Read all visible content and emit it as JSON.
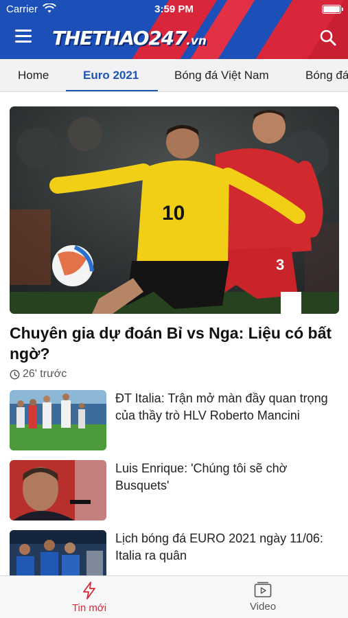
{
  "status_bar": {
    "carrier": "Carrier",
    "time": "3:59 PM"
  },
  "header": {
    "logo_main": "THETHAO247",
    "logo_tld": ".vn"
  },
  "tabs": [
    {
      "label": "Home"
    },
    {
      "label": "Euro 2021"
    },
    {
      "label": "Bóng đá Việt Nam"
    },
    {
      "label": "Bóng đá"
    }
  ],
  "hero": {
    "title": "Chuyên gia dự đoán Bỉ vs Nga: Liệu có bất ngờ?",
    "time": "26' trước",
    "jersey_left": "10",
    "jersey_right": "3"
  },
  "articles": [
    {
      "title": "ĐT Italia: Trận mở màn đầy quan trọng của thầy trò HLV Roberto Mancini"
    },
    {
      "title": "Luis Enrique: 'Chúng tôi sẽ chờ Busquets'"
    },
    {
      "title": "Lịch bóng đá EURO 2021 ngày 11/06: Italia ra quân"
    }
  ],
  "bottom_nav": [
    {
      "label": "Tin mới",
      "icon": "lightning-icon"
    },
    {
      "label": "Video",
      "icon": "video-play-icon"
    }
  ],
  "colors": {
    "header_blue": "#1d4fb8",
    "header_red": "#d9263a",
    "accent": "#1e55b3",
    "active_nav": "#d9263a"
  }
}
